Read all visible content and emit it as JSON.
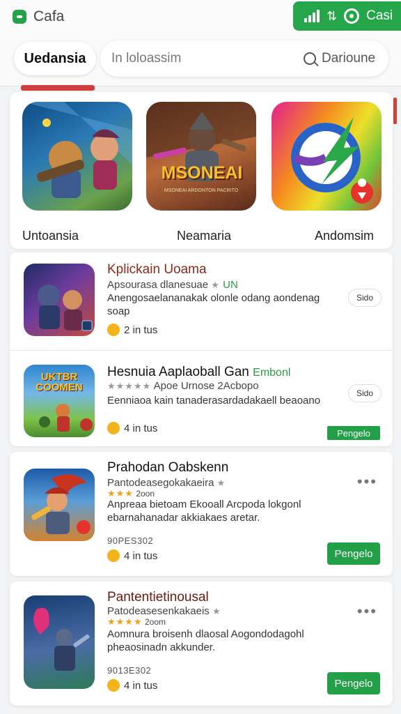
{
  "status_bar": {
    "app_title": "Cafa",
    "right_label": "Casi",
    "accent": "#26a64a"
  },
  "search": {
    "tab_label": "Uedansia",
    "placeholder": "In loloassim",
    "scope_label": "Darioune"
  },
  "featured": [
    {
      "label": "Untoansia",
      "icon": "game-icon-heroes"
    },
    {
      "label": "Neamaria",
      "icon": "game-icon-warrior",
      "art_text": "MSONEAI",
      "art_subtext": "MSONEAI ARDONTON PACRITO"
    },
    {
      "label": "Andomsim",
      "icon": "app-icon-lightning-circle"
    }
  ],
  "list": [
    {
      "title": "Kplickain Uoama",
      "subtitle": "Apsourasa dlanesuae",
      "tag": "UN",
      "desc": "Anengosaelananakak olonle odang aondenag soap",
      "meta": "2 in tus",
      "chip": "Sido"
    },
    {
      "title": "Hesnuia Aaplaoball Gan",
      "tag": "Embonl",
      "subtitle": "Apoe Urnose 2Acbopo",
      "desc": "Eenniaoa kain tanaderasardadakaell beaoano",
      "meta": "4 in tus",
      "chip": "Sido",
      "button": "Pengelo",
      "art_text": "UKTBR COOMEN"
    },
    {
      "title": "Prahodan Oabskenn",
      "subtitle": "Pantodeasegokakaeira",
      "rating_text": "2oon",
      "desc": "Anpreaa bietoam Ekooall Arcpoda lokgonl ebarnahanadar akkiakaes aretar.",
      "code": "90PES302",
      "meta": "4 in tus",
      "button": "Pengelo"
    },
    {
      "title": "Pantentietinousal",
      "subtitle": "Patodeasesenkakaeis",
      "rating_text": "2oom",
      "desc": "Aomnura broisenh dlaosal Aogondodagohl pheaosinadn akkunder.",
      "code": "9013E302",
      "meta": "4 in tus",
      "button": "Pengelo"
    }
  ]
}
